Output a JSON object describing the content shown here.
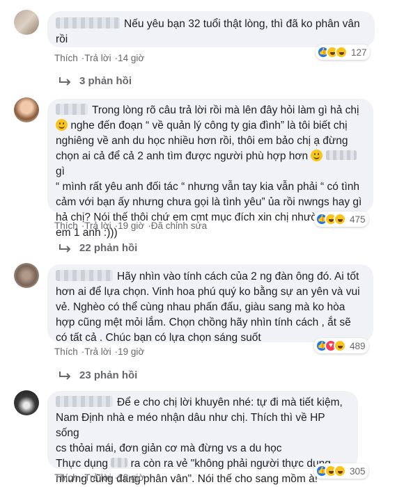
{
  "comments": [
    {
      "text": "Nếu yêu bạn 32 tuổi thật lòng, thì đã ko phân vân rồi",
      "line1": "Nếu yêu bạn 32 tuổi thật lòng, thì đã ko phân vân",
      "line2": "rồi",
      "actions": {
        "like": "Thích",
        "reply": "Trả lời",
        "time": "14 giờ"
      },
      "reaction_count": "127",
      "replies": "3 phản hồi"
    },
    {
      "lines": [
        "Trong lòng rõ câu trả lời rồi mà lên đây hỏi làm gì hả chị",
        "nghe đến đoạn “ về quản lý công ty gia đình” là tôi biết chị",
        "nghiêng về anh du học nhiều hơn rồi, thôi em bảo chị ạ đừng",
        "chọn ai cả để cả 2 anh tìm được người phù hợp hơn",
        "gì",
        "“ mình rất yêu anh đối tác “ nhưng vẫn tay kia vẫn phải “ có tình",
        "cảm với bạn ấy nhưng chưa gọi là tình yêu” ủa rồi nwngs hay gì",
        "hả chị? Nói thế thôi chứ em cmt mục đích xin chị nhường cho",
        "em 1 anh :)))"
      ],
      "actions": {
        "like": "Thích",
        "reply": "Trả lời",
        "time": "19 giờ",
        "edited": "Đã chỉnh sửa"
      },
      "reaction_count": "475",
      "replies": "22 phản hồi"
    },
    {
      "lines": [
        "Hãy nhìn vào tính cách của 2 ng đàn ông đó. Ai tốt",
        "hơn ai để lựa chọn. Vinh hoa phú quý ko bằng sự an yên và vui",
        "vẻ. Nghèo có thể cùng nhau phấn đấu, giàu sang mà ko hòa",
        "hợp cũng mệt mỏi lắm. Chọn chồng hãy nhìn tính cách , ắt sẽ",
        "có tất cả . Chúc bạn có lựa chọn sáng suốt"
      ],
      "actions": {
        "like": "Thích",
        "reply": "Trả lời",
        "time": "19 giờ"
      },
      "reaction_count": "489",
      "replies": "23 phản hồi"
    },
    {
      "lines": [
        "Để e cho chị lời khuyên nhé: tự đi mà tiết kiệm,",
        "Nam Định nhà e méo nhận dâu như chị. Thích thì về HP sống",
        "cs thỏai mái, đơn giản cơ mà đừng vs a du học",
        "Thực dụng",
        "ra còn ra vẻ \"không phải người thực dụng",
        "nhưng cũng đang phân vân\". Nói thế cho sang mồm à!"
      ],
      "actions": {
        "like": "Thích",
        "reply": "Trả lời",
        "time": "18 giờ"
      },
      "reaction_count": "305"
    }
  ],
  "colors": {
    "like": "#1877f2",
    "haha": "#f7c51e",
    "love": "#f33e58",
    "bubble": "#f0f2f5",
    "meta": "#65676b"
  }
}
